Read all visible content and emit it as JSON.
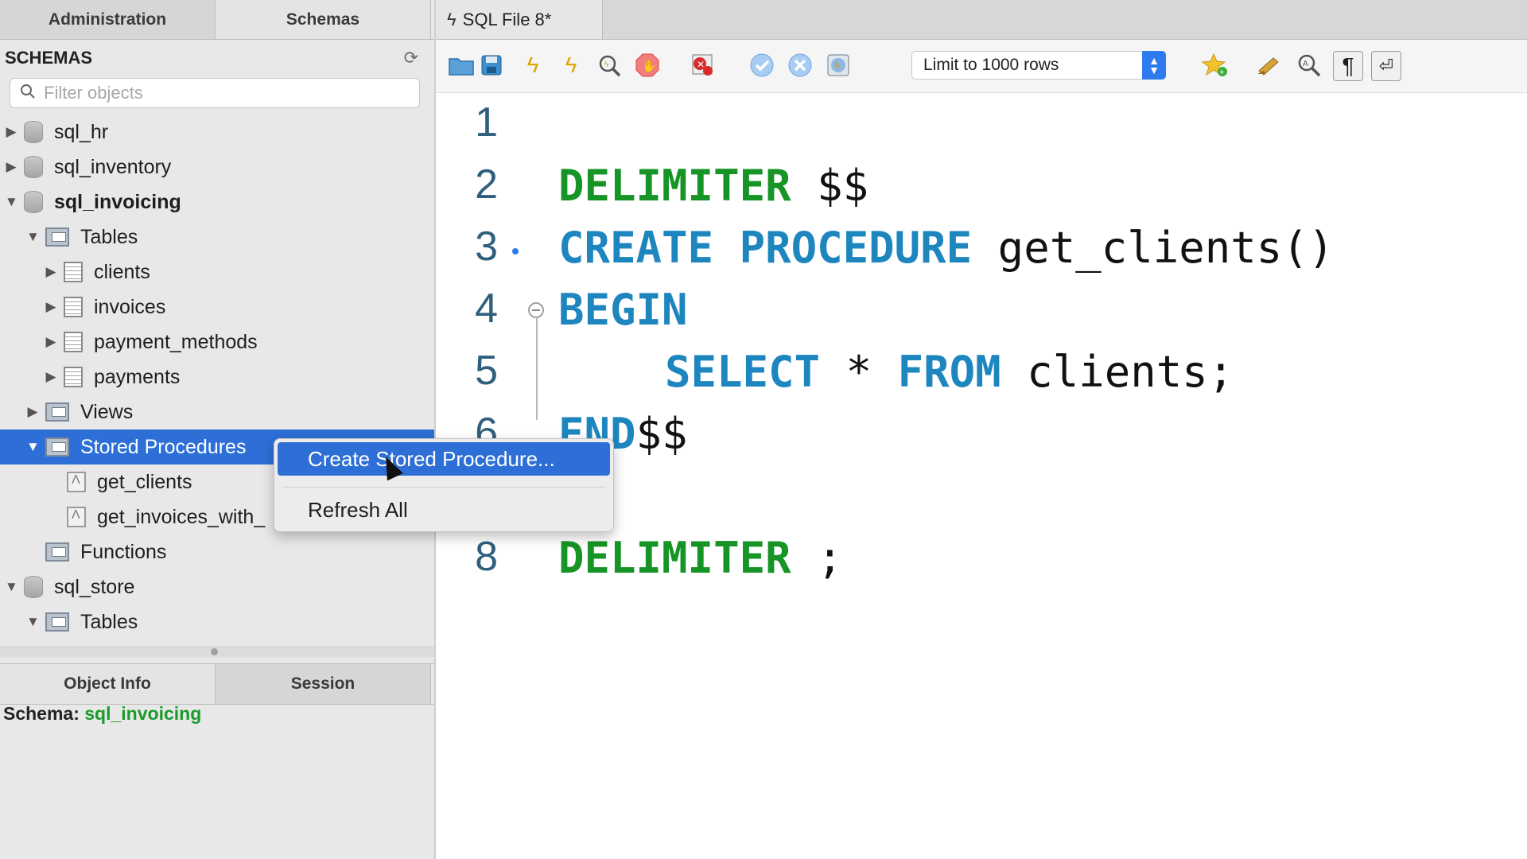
{
  "tabs": {
    "administration": "Administration",
    "schemas": "Schemas"
  },
  "sidebar": {
    "title": "SCHEMAS",
    "filter_placeholder": "Filter objects",
    "tree": [
      {
        "label": "sql_hr"
      },
      {
        "label": "sql_inventory"
      },
      {
        "label": "sql_invoicing"
      },
      {
        "label": "Tables"
      },
      {
        "label": "clients"
      },
      {
        "label": "invoices"
      },
      {
        "label": "payment_methods"
      },
      {
        "label": "payments"
      },
      {
        "label": "Views"
      },
      {
        "label": "Stored Procedures"
      },
      {
        "label": "get_clients"
      },
      {
        "label": "get_invoices_with_"
      },
      {
        "label": "Functions"
      },
      {
        "label": "sql_store"
      },
      {
        "label": "Tables"
      }
    ]
  },
  "bottom_tabs": {
    "object_info": "Object Info",
    "session": "Session"
  },
  "object_info": {
    "label": "Schema:",
    "value": "sql_invoicing"
  },
  "editor": {
    "tab_title": "SQL File 8*",
    "limit_select": "Limit to 1000 rows",
    "lines": [
      {
        "n": "1"
      },
      {
        "n": "2"
      },
      {
        "n": "3"
      },
      {
        "n": "4"
      },
      {
        "n": "5"
      },
      {
        "n": "6"
      },
      {
        "n": "8"
      }
    ],
    "code": {
      "l2_kw": "DELIMITER",
      "l2_rest": " $$",
      "l3_kw": "CREATE PROCEDURE",
      "l3_rest": " get_clients()",
      "l4_kw": "BEGIN",
      "l5_kw1": "SELECT",
      "l5_star": " * ",
      "l5_kw2": "FROM",
      "l5_rest": " clients;",
      "l6_kw": "END",
      "l6_rest": "$$",
      "l8_kw": "DELIMITER",
      "l8_rest": " ;"
    }
  },
  "context_menu": {
    "create": "Create Stored Procedure...",
    "refresh": "Refresh All"
  },
  "colors": {
    "selection": "#2d6fd6",
    "keyword_green": "#169425",
    "keyword_blue": "#1e86bf",
    "schema_value": "#1a9a2a"
  }
}
